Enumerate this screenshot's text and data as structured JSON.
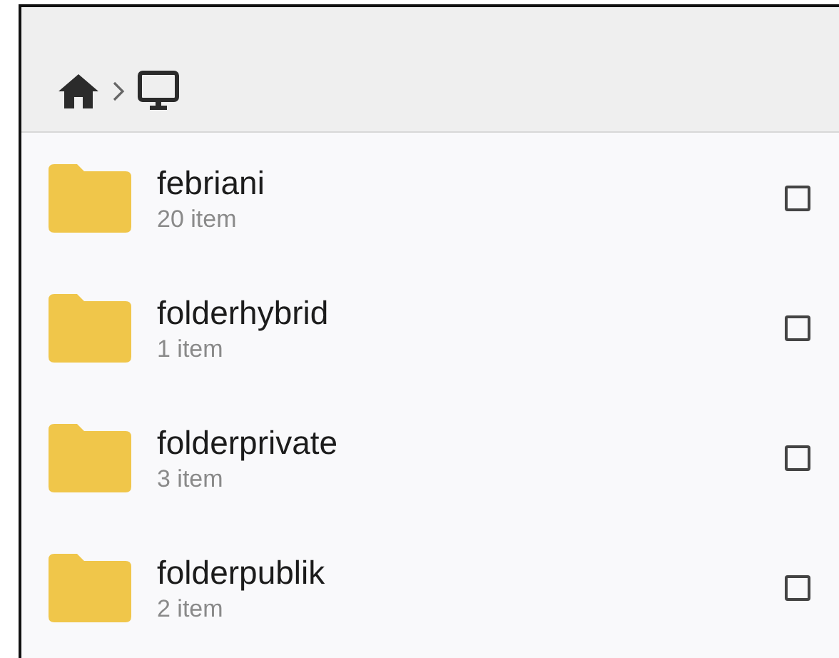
{
  "breadcrumb": [
    {
      "kind": "home"
    },
    {
      "kind": "desktop"
    }
  ],
  "folders": [
    {
      "name": "febriani",
      "count": "20 item",
      "checked": false
    },
    {
      "name": "folderhybrid",
      "count": "1 item",
      "checked": false
    },
    {
      "name": "folderprivate",
      "count": "3 item",
      "checked": false
    },
    {
      "name": "folderpublik",
      "count": "2 item",
      "checked": false
    }
  ]
}
